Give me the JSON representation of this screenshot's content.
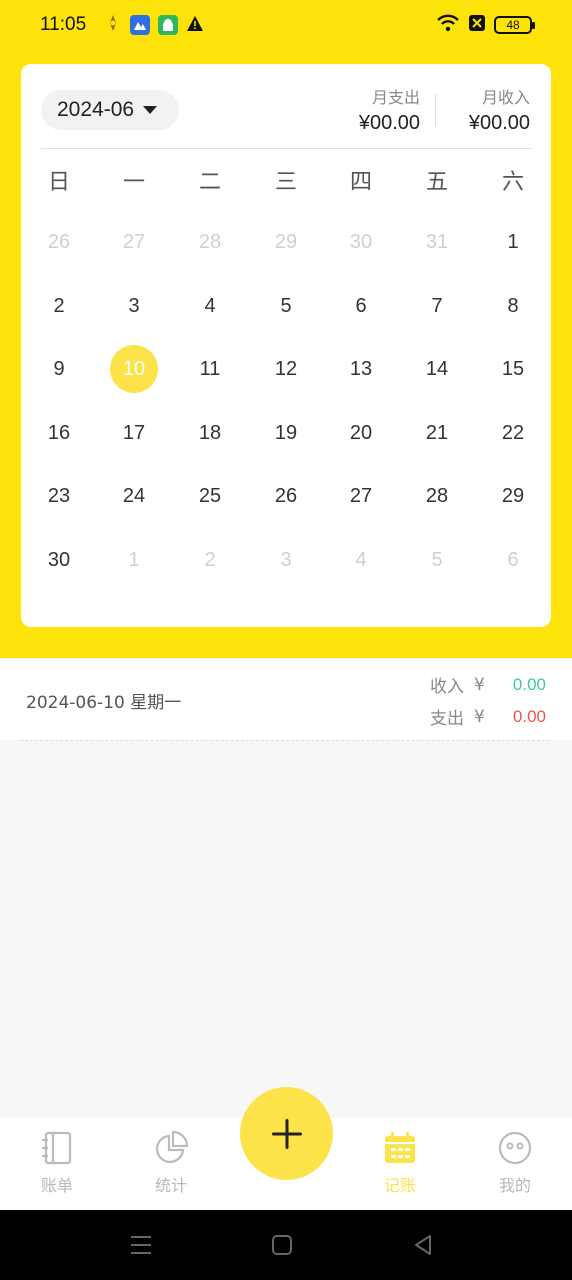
{
  "status_bar": {
    "time": "11:05",
    "battery": "48"
  },
  "calendar": {
    "month": "2024-06",
    "expense_label": "月支出",
    "expense_value": "¥00.00",
    "income_label": "月收入",
    "income_value": "¥00.00",
    "weekdays": [
      "日",
      "一",
      "二",
      "三",
      "四",
      "五",
      "六"
    ],
    "weeks": [
      [
        "26",
        "27",
        "28",
        "29",
        "30",
        "31",
        "1"
      ],
      [
        "2",
        "3",
        "4",
        "5",
        "6",
        "7",
        "8"
      ],
      [
        "9",
        "10",
        "11",
        "12",
        "13",
        "14",
        "15"
      ],
      [
        "16",
        "17",
        "18",
        "19",
        "20",
        "21",
        "22"
      ],
      [
        "23",
        "24",
        "25",
        "26",
        "27",
        "28",
        "29"
      ],
      [
        "30",
        "1",
        "2",
        "3",
        "4",
        "5",
        "6"
      ]
    ],
    "selected_day": "10"
  },
  "day_summary": {
    "date": "2024-06-10 星期一",
    "income_label": "收入",
    "income_currency": "¥",
    "income_value": "0.00",
    "expense_label": "支出",
    "expense_currency": "¥",
    "expense_value": "0.00"
  },
  "bottom_nav": {
    "items": [
      {
        "label": "账单",
        "icon": "notebook-icon"
      },
      {
        "label": "统计",
        "icon": "pie-chart-icon"
      },
      {
        "label": "记账",
        "icon": "calendar-icon"
      },
      {
        "label": "我的",
        "icon": "smiley-icon"
      }
    ],
    "active": "记账",
    "fab_icon": "plus-icon"
  },
  "colors": {
    "accent": "#fde30a",
    "selected": "#fde34a",
    "income": "#3fc9a0",
    "expense": "#ef5350"
  }
}
